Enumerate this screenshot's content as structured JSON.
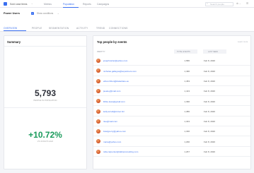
{
  "topnav": {
    "app_name": "Sold Lead Items",
    "items": [
      "Metrics",
      "Population",
      "Reports",
      "Campaigns"
    ],
    "active": 1,
    "search_placeholder": "Search people"
  },
  "cohort": {
    "title": "Power Users",
    "conditions": "Show conditions"
  },
  "tabs": {
    "items": [
      "OVERVIEW",
      "PEOPLE",
      "SEGMENTATION",
      "ACTIVITY",
      "TREND",
      "CONNECTIONS"
    ],
    "active": 0
  },
  "summary": {
    "title": "Summary",
    "total_people": "5,793",
    "total_people_caption": "PEOPLE IN POPULATION",
    "percent": "+10.72%",
    "percent_caption": "VS 30 DAYS AGO"
  },
  "top_people": {
    "title": "Top people by events",
    "help": "Learn more",
    "columns": [
      "IDENTITY",
      "TOTAL EVENTS",
      "LAST SEEN"
    ],
    "rows": [
      {
        "email": "josephcarter@yahoo.com",
        "events": "1,586",
        "last_seen": "Feb 8, 2020"
      },
      {
        "email": "nicholas.gallegos@sopartners.com",
        "events": "1,496",
        "last_seen": "Feb 8, 2020"
      },
      {
        "email": "ethan.hilton@datashare.eu",
        "events": "1,453",
        "last_seen": "Feb 8, 2020"
      },
      {
        "email": "jseeley@mail.com",
        "events": "1,413",
        "last_seen": "Feb 8, 2020"
      },
      {
        "email": "libbie.lowe@gmail.com",
        "events": "1,396",
        "last_seen": "Feb 8, 2020"
      },
      {
        "email": "kelly.terrell@cmtec.biz",
        "events": "1,386",
        "last_seen": "Feb 8, 2020"
      },
      {
        "email": "rlee@mail.com",
        "events": "1,343",
        "last_seen": "Feb 8, 2020"
      },
      {
        "email": "bradyperry@yahoo.com",
        "events": "1,336",
        "last_seen": "Feb 8, 2020"
      },
      {
        "email": "marie@yahoo.com",
        "events": "1,296",
        "last_seen": "Feb 8, 2020"
      },
      {
        "email": "tulla.carpenter@dahipconsulting.com",
        "events": "1,267",
        "last_seen": "Feb 8, 2020"
      }
    ]
  },
  "colors": {
    "accent": "#3a6ff0",
    "positive": "#1a9b5c"
  }
}
